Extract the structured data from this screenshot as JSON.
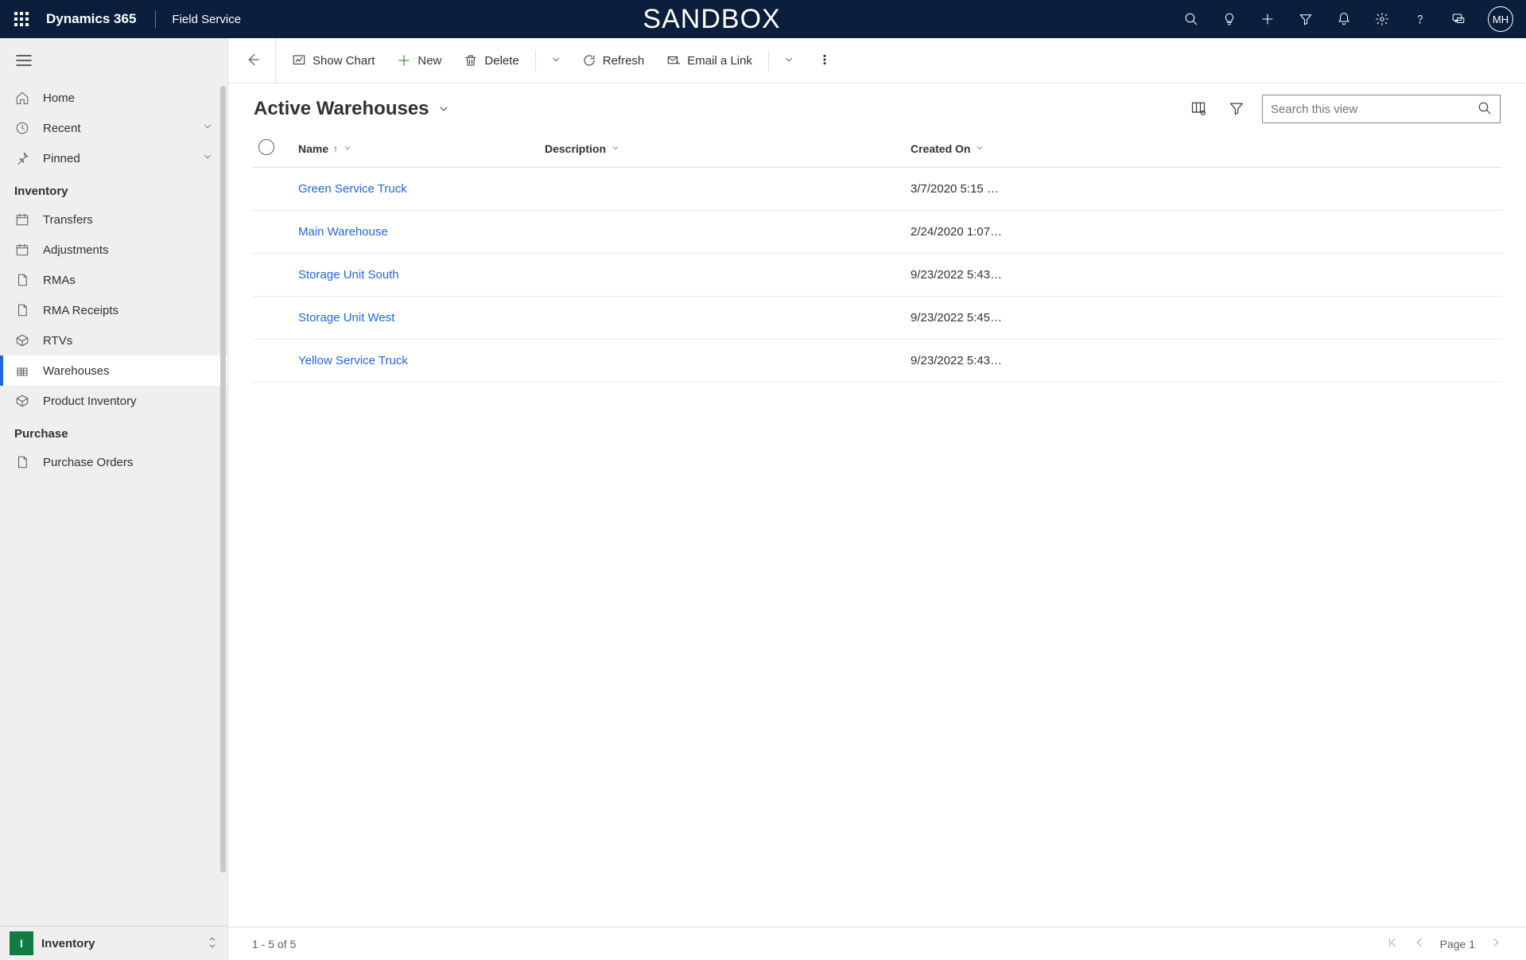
{
  "topbar": {
    "brand": "Dynamics 365",
    "module": "Field Service",
    "environment": "SANDBOX",
    "avatar": "MH"
  },
  "sidebar": {
    "top_items": [
      {
        "label": "Home"
      },
      {
        "label": "Recent",
        "expandable": true
      },
      {
        "label": "Pinned",
        "expandable": true
      }
    ],
    "sections": [
      {
        "title": "Inventory",
        "items": [
          {
            "label": "Transfers"
          },
          {
            "label": "Adjustments"
          },
          {
            "label": "RMAs"
          },
          {
            "label": "RMA Receipts"
          },
          {
            "label": "RTVs"
          },
          {
            "label": "Warehouses",
            "active": true
          },
          {
            "label": "Product Inventory"
          }
        ]
      },
      {
        "title": "Purchase",
        "items": [
          {
            "label": "Purchase Orders"
          }
        ]
      }
    ],
    "area": {
      "badge": "I",
      "name": "Inventory"
    }
  },
  "commands": {
    "show_chart": "Show Chart",
    "new": "New",
    "delete": "Delete",
    "refresh": "Refresh",
    "email_link": "Email a Link"
  },
  "view": {
    "title": "Active Warehouses",
    "search_placeholder": "Search this view"
  },
  "grid": {
    "columns": {
      "name": "Name",
      "description": "Description",
      "created_on": "Created On"
    },
    "rows": [
      {
        "name": "Green Service Truck",
        "description": "",
        "created_on": "3/7/2020 5:15 …"
      },
      {
        "name": "Main Warehouse",
        "description": "",
        "created_on": "2/24/2020 1:07…"
      },
      {
        "name": "Storage Unit South",
        "description": "",
        "created_on": "9/23/2022 5:43…"
      },
      {
        "name": "Storage Unit West",
        "description": "",
        "created_on": "9/23/2022 5:45…"
      },
      {
        "name": "Yellow Service Truck",
        "description": "",
        "created_on": "9/23/2022 5:43…"
      }
    ]
  },
  "footer": {
    "count": "1 - 5 of 5",
    "page": "Page 1"
  }
}
